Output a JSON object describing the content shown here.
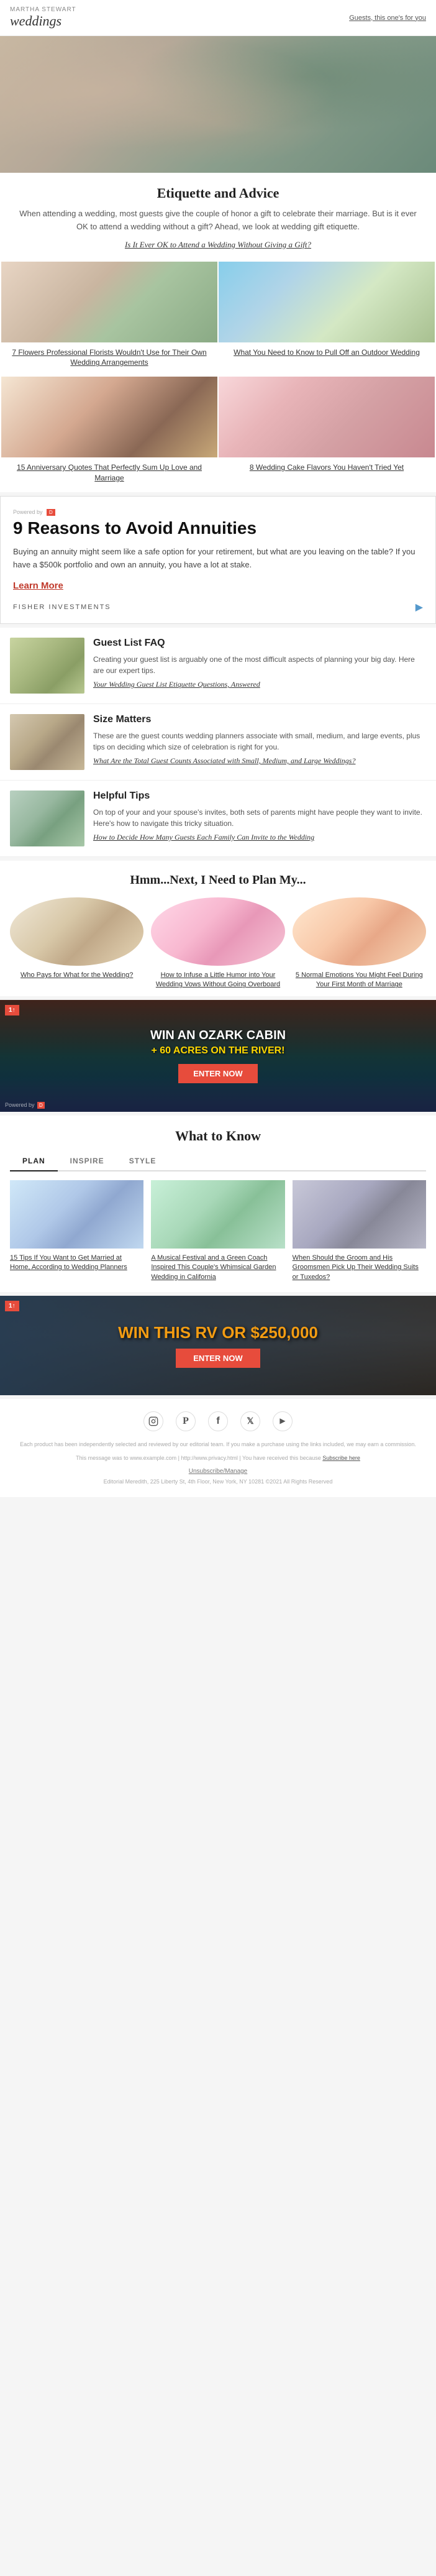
{
  "header": {
    "logo_small": "MARTHA STEWART",
    "logo_main": "weddings",
    "guest_link": "Guests, this one's for you"
  },
  "etiquette": {
    "title": "Etiquette and Advice",
    "description": "When attending a wedding, most guests give the couple of honor a gift to celebrate their marriage. But is it ever OK to attend a wedding without a gift? Ahead, we look at wedding gift etiquette.",
    "link_text": "Is It Ever OK to Attend a Wedding Without Giving a Gift?"
  },
  "article_grid": [
    {
      "title": "7 Flowers Professional Florists Wouldn't Use for Their Own Wedding Arrangements",
      "img_class": "img-flowers"
    },
    {
      "title": "What You Need to Know to Pull Off an Outdoor Wedding",
      "img_class": "img-outdoor"
    },
    {
      "title": "15 Anniversary Quotes That Perfectly Sum Up Love and Marriage",
      "img_class": "img-couple"
    },
    {
      "title": "8 Wedding Cake Flavors You Haven't Tried Yet",
      "img_class": "img-cake"
    }
  ],
  "ad": {
    "powered_label": "Powered by",
    "headline": "9 Reasons to Avoid Annuities",
    "body": "Buying an annuity might seem like a safe option for your retirement, but what are you leaving on the table? If you have a $500k portfolio and own an annuity, you have a lot at stake.",
    "learn_more": "Learn More",
    "sponsor": "FISHER INVESTMENTS",
    "arrow": "▶"
  },
  "faq_sections": [
    {
      "id": "guest-list",
      "heading": "Guest List FAQ",
      "description": "Creating your guest list is arguably one of the most difficult aspects of planning your big day. Here are our expert tips.",
      "link_text": "Your Wedding Guest List Etiquette Questions, Answered",
      "img_class": "img-guests"
    },
    {
      "id": "size-matters",
      "heading": "Size Matters",
      "description": "These are the guest counts wedding planners associate with small, medium, and large events, plus tips on deciding which size of celebration is right for you.",
      "link_text": "What Are the Total Guest Counts Associated with Small, Medium, and Large Weddings?",
      "img_class": "img-crowd"
    },
    {
      "id": "helpful-tips",
      "heading": "Helpful Tips",
      "description": "On top of your and your spouse's invites, both sets of parents might have people they want to invite. Here's how to navigate this tricky situation.",
      "link_text": "How to Decide How Many Guests Each Family Can Invite to the Wedding",
      "img_class": "img-family"
    }
  ],
  "hmm_section": {
    "title": "Hmm...Next, I Need to Plan My...",
    "cards": [
      {
        "title": "Who Pays for What for the Wedding?",
        "img_class": "img-planning"
      },
      {
        "title": "How to Infuse a Little Humor into Your Wedding Vows Without Going Overboard",
        "img_class": "img-ribbon"
      },
      {
        "title": "5 Normal Emotions You Might Feel During Your First Month of Marriage",
        "img_class": "img-emotion"
      }
    ]
  },
  "ozark_ad": {
    "icon": "1↑",
    "headline": "WIN AN OZARK CABIN",
    "subheadline": "+ 60 ACRES ON THE RIVER!",
    "button": "ENTER NOW",
    "powered": "Powered by"
  },
  "what_to_know": {
    "title": "What to Know",
    "tabs": [
      {
        "label": "PLAN",
        "active": true
      },
      {
        "label": "INSPIRE",
        "active": false
      },
      {
        "label": "STYLE",
        "active": false
      }
    ],
    "cards": [
      {
        "title": "15 Tips If You Want to Get Married at Home, According to Wedding Planners",
        "img_class": "img-house"
      },
      {
        "title": "A Musical Festival and a Green Coach Inspired This Couple's Whimsical Garden Wedding in California",
        "img_class": "img-festival"
      },
      {
        "title": "When Should the Groom and His Groomsmen Pick Up Their Wedding Suits or Tuxedos?",
        "img_class": "img-groom"
      }
    ]
  },
  "rv_banner": {
    "icon": "1↑",
    "headline_part1": "WIN THIS RV OR",
    "headline_part2": "$250,000",
    "button": "ENTER NOW"
  },
  "footer": {
    "social_icons": [
      {
        "name": "instagram",
        "symbol": "📷"
      },
      {
        "name": "pinterest",
        "symbol": "P"
      },
      {
        "name": "facebook",
        "symbol": "f"
      },
      {
        "name": "twitter",
        "symbol": "𝕏"
      },
      {
        "name": "youtube",
        "symbol": "▶"
      }
    ],
    "legal_text": "Each product has been independently selected and reviewed by our editorial team. If you make a purchase using the links included, we may earn a commission.",
    "privacy_text": "This message was to www.example.com | http://www.privacy.html | You have received this because",
    "subscribe_link": "Subscribe here",
    "unsubscribe": "Unsubscribe/Manage",
    "address": "Editorial Meredith, 225 Liberty St, 4th Floor, New York, NY 10281 ©2021 All Rights Reserved"
  }
}
